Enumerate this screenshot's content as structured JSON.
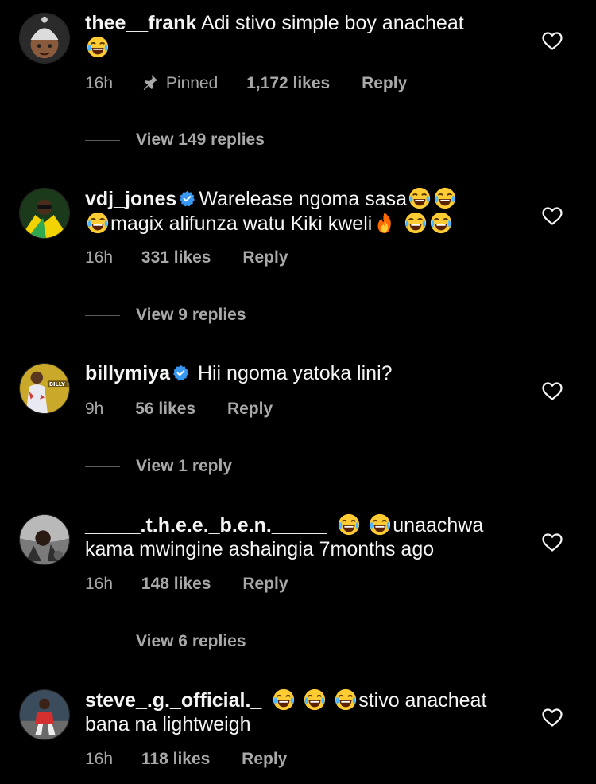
{
  "comments": [
    {
      "username": "thee__frank",
      "text_1": "Adi stivo simple boy anacheat",
      "time": "16h",
      "pinned_label": "Pinned",
      "likes": "1,172 likes",
      "reply": "Reply",
      "view_replies": "View 149 replies"
    },
    {
      "username": "vdj_jones",
      "text_1": "Warelease ngoma sasa",
      "text_2": "magix alifunza watu Kiki kweli",
      "time": "16h",
      "likes": "331 likes",
      "reply": "Reply",
      "view_replies": "View 9 replies"
    },
    {
      "username": "billymiya",
      "text_1": "Hii ngoma yatoka lini?",
      "time": "9h",
      "likes": "56 likes",
      "reply": "Reply",
      "view_replies": "View 1 reply",
      "avatar_text": "BILLY MIYA"
    },
    {
      "username": "_____.t.h.e.e._b.e.n._____",
      "text_1": "unaachwa",
      "text_2": "kama mwingine ashaingia 7months ago",
      "time": "16h",
      "likes": "148 likes",
      "reply": "Reply",
      "view_replies": "View 6 replies"
    },
    {
      "username": "steve_.g._official._",
      "text_1": "stivo anacheat",
      "text_2": "bana na lightweigh",
      "time": "16h",
      "likes": "118 likes",
      "reply": "Reply"
    }
  ],
  "icons": {
    "heart": "heart-outline-icon",
    "pin": "pin-icon",
    "verified": "verified-badge-icon",
    "emoji_laugh": "face-with-tears-of-joy",
    "emoji_fire": "fire"
  },
  "colors": {
    "background": "#000000",
    "text": "#f5f5f5",
    "secondary": "#a8a8a8",
    "verified": "#3897f0"
  }
}
